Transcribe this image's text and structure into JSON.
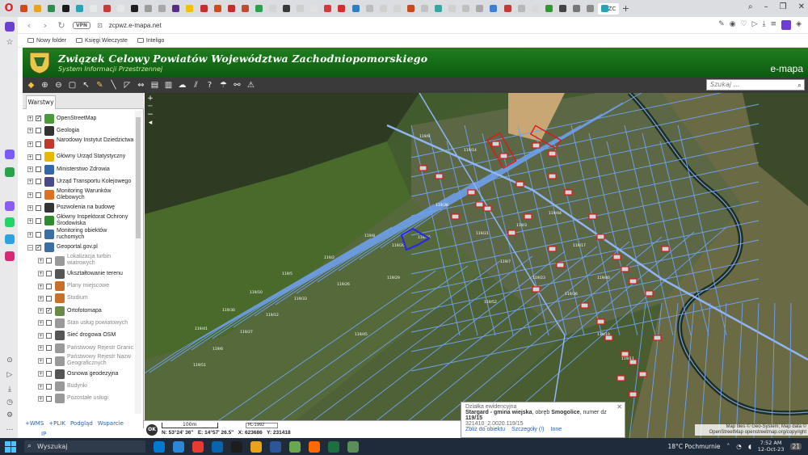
{
  "browser": {
    "url": "zcpwz.e-mapa.net",
    "vpn_label": "VPN",
    "active_tab_label": "ZC",
    "tab_colors": [
      "#d9461c",
      "#e8a21c",
      "#2d8f4e",
      "#1b1b1b",
      "#2aa3b4",
      "#e9e9e9",
      "#c73a3a",
      "#e6e6e6",
      "#1f1f1f",
      "#9b9b9b",
      "#a8a8a8",
      "#5a2d8a",
      "#f2c200",
      "#c72d2d",
      "#d14b1b",
      "#c42e2e",
      "#c44a2e",
      "#2ba14e",
      "#d4d4d4",
      "#3a3a3a",
      "#cfcfcf",
      "#e0e0e0",
      "#d13b3b",
      "#d62e2e",
      "#2d7fc1",
      "#bdbdbd",
      "#d0d0d0",
      "#d4d4d4",
      "#c94a1b",
      "#c2c2c2",
      "#37a7a0",
      "#d0d0d0",
      "#c0c0c0",
      "#aaaaaa",
      "#3f7fcf",
      "#c33a3a",
      "#b8b8b8",
      "#d9d9d9",
      "#2e9b2e",
      "#444444",
      "#777777",
      "#8b8b8b",
      "#2aa3b4"
    ]
  },
  "bookmarks": [
    {
      "label": "Nowy folder",
      "icon": "folder-icon"
    },
    {
      "label": "Księgi Wieczyste",
      "icon": "gear-icon"
    },
    {
      "label": "Inteligo",
      "icon": "circle-icon"
    }
  ],
  "header": {
    "title": "Związek Celowy Powiatów Województwa Zachodniopomorskiego",
    "subtitle": "System Informacji Przestrzennej",
    "brand": "e-mapa"
  },
  "toolbar": {
    "search_placeholder": "Szukaj ..."
  },
  "panel": {
    "tab_label": "Warstwy",
    "layers": [
      {
        "label": "OpenStreetMap",
        "checked": true,
        "level": 0,
        "color": "#4a9a3a",
        "dim": false,
        "icon": "openstreetmap-icon"
      },
      {
        "label": "Geologia",
        "checked": false,
        "level": 0,
        "color": "#333333",
        "dim": false,
        "icon": "hammer-icon"
      },
      {
        "label": "Narodowy Instytut Dziedzictwa",
        "checked": false,
        "level": 0,
        "color": "#c0392b",
        "dim": false,
        "icon": "heritage-icon"
      },
      {
        "label": "Główny Urząd Statystyczny",
        "checked": false,
        "level": 0,
        "color": "#e6b800",
        "dim": false,
        "icon": "statistics-icon"
      },
      {
        "label": "Ministerstwo Zdrowia",
        "checked": false,
        "level": 0,
        "color": "#3366aa",
        "dim": false,
        "icon": "health-icon"
      },
      {
        "label": "Urząd Transportu Kolejowego",
        "checked": false,
        "level": 0,
        "color": "#4a4a8a",
        "dim": false,
        "icon": "railway-icon"
      },
      {
        "label": "Monitoring Warunków Glebowych",
        "checked": false,
        "level": 0,
        "color": "#e07020",
        "dim": false,
        "icon": "soil-icon"
      },
      {
        "label": "Pozwolenia na budowę",
        "checked": false,
        "level": 0,
        "color": "#333333",
        "dim": false,
        "icon": "building-permit-icon"
      },
      {
        "label": "Główny Inspektorat Ochrony Środowiska",
        "checked": false,
        "level": 0,
        "color": "#2e8b2e",
        "dim": false,
        "icon": "environment-icon"
      },
      {
        "label": "Monitoring obiektów ruchomych",
        "checked": false,
        "level": 0,
        "color": "#3b6ea5",
        "dim": false,
        "icon": "satellite-icon"
      },
      {
        "label": "Geoportal.gov.pl",
        "checked": true,
        "level": 0,
        "color": "#3b6ea5",
        "dim": false,
        "icon": "geoportal-icon"
      },
      {
        "label": "Lokalizacja turbin wiatrowych",
        "checked": false,
        "level": 1,
        "color": "#999999",
        "dim": true,
        "icon": "wind-turbine-icon"
      },
      {
        "label": "Ukształtowanie terenu",
        "checked": false,
        "level": 1,
        "color": "#555555",
        "dim": false,
        "icon": "terrain-icon"
      },
      {
        "label": "Plany miejscowe",
        "checked": false,
        "level": 1,
        "color": "#c8702a",
        "dim": true,
        "icon": "plans-icon"
      },
      {
        "label": "Studium",
        "checked": false,
        "level": 1,
        "color": "#c8702a",
        "dim": true,
        "icon": "study-icon"
      },
      {
        "label": "Ortofotomapa",
        "checked": true,
        "level": 1,
        "color": "#6a8a4a",
        "dim": false,
        "icon": "orthophoto-icon"
      },
      {
        "label": "Stan usług powiatowych",
        "checked": false,
        "level": 1,
        "color": "#999999",
        "dim": true,
        "icon": "services-icon"
      },
      {
        "label": "Sieć drogowa OSM",
        "checked": false,
        "level": 1,
        "color": "#555555",
        "dim": false,
        "icon": "road-network-icon"
      },
      {
        "label": "Państwowy Rejestr Granic",
        "checked": false,
        "level": 1,
        "color": "#999999",
        "dim": true,
        "icon": "borders-icon"
      },
      {
        "label": "Państwowy Rejestr Nazw Geograficznych",
        "checked": false,
        "level": 1,
        "color": "#999999",
        "dim": true,
        "icon": "geonames-icon"
      },
      {
        "label": "Osnowa geodezyjna",
        "checked": false,
        "level": 1,
        "color": "#555555",
        "dim": false,
        "icon": "geodetic-network-icon"
      },
      {
        "label": "Budynki",
        "checked": false,
        "level": 1,
        "color": "#999999",
        "dim": true,
        "icon": "buildings-icon"
      },
      {
        "label": "Pozostałe usługi",
        "checked": false,
        "level": 1,
        "color": "#999999",
        "dim": true,
        "icon": "other-services-icon"
      }
    ],
    "footer_links": [
      "+WMS",
      "+PLIK",
      "Podgląd",
      "Wsparcie"
    ],
    "footer_ip": "IP"
  },
  "map": {
    "parcel_labels": [
      "119/15",
      "119/20",
      "119/8",
      "119/2",
      "119/5",
      "119/10",
      "119/30",
      "119/41",
      "119/26",
      "119/33",
      "119/12",
      "119/27",
      "119/6",
      "119/51",
      "119/9",
      "119/14",
      "119/38",
      "119/21",
      "119/3",
      "119/44",
      "119/17",
      "119/40",
      "119/23",
      "119/7",
      "119/36",
      "119/19",
      "119/11",
      "119/52",
      "119/29",
      "119/45"
    ],
    "info": {
      "heading": "Działka ewidencyjna",
      "body_bold_prefix": "Stargard - gmina wiejska",
      "body_mid": ", obręb ",
      "body_bold_mid": "Smogolice",
      "body_suffix": ", numer dz ",
      "body_bold_suffix": "119/15",
      "code": "321410_2.0020.119/15",
      "links": [
        "Zbliż do obiektu",
        "Szczegóły (!)",
        "Inne"
      ]
    },
    "attribution": "Map tiles © Geo-System; Map data © OpenStreetMap openstreetmap.org/copyright"
  },
  "status": {
    "ok_label": "OK",
    "scale_label": "100m",
    "crs": "PL-1992",
    "lat": "N: 53°24' 36\"",
    "lon": "E: 14°57' 26.5\"",
    "x": "X: 623686",
    "y": "Y: 231418"
  },
  "taskbar": {
    "search": "Wyszukaj",
    "weather": "18°C  Pochmurnie",
    "time": "7:52 AM",
    "date": "12-Oct-23",
    "notif": "21",
    "app_colors": [
      "#0078d4",
      "#2b88d8",
      "#e63b2e",
      "#0a64ad",
      "#1d1d1d",
      "#e8a317",
      "#2b579a",
      "#6aa84f",
      "#ff6a00",
      "#1d6f42",
      "#5a8f5a"
    ]
  }
}
